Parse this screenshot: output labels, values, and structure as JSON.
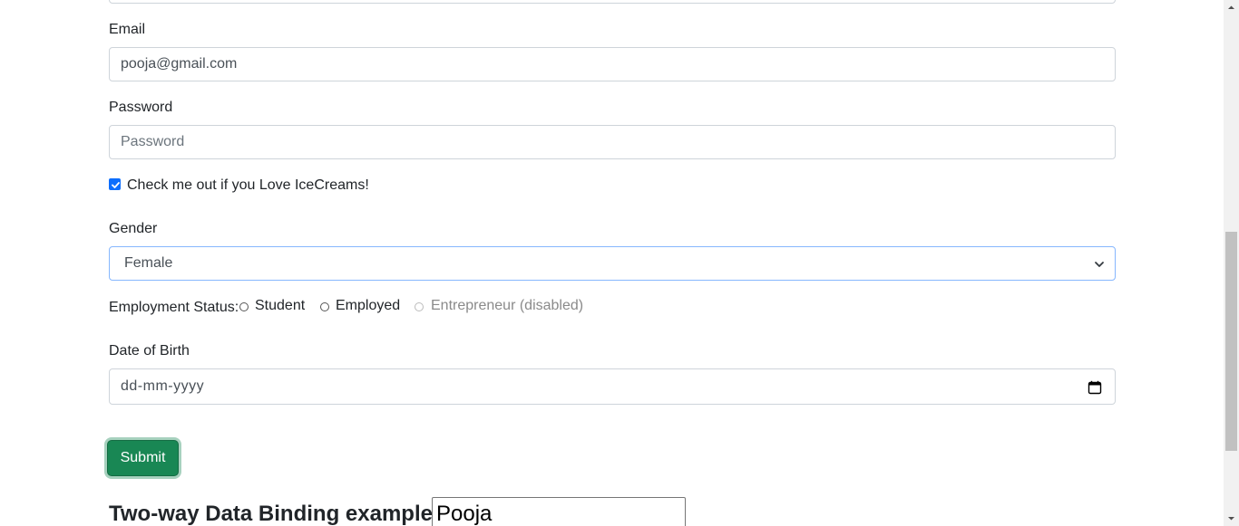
{
  "form": {
    "email_label": "Email",
    "email_value": "pooja@gmail.com",
    "password_label": "Password",
    "password_placeholder": "Password",
    "checkbox_label": "Check me out if you Love IceCreams!",
    "checkbox_checked": true,
    "gender_label": "Gender",
    "gender_selected": "Female",
    "employment_label": "Employment Status:",
    "employment_options": [
      {
        "label": "Student",
        "disabled": false
      },
      {
        "label": "Employed",
        "disabled": false
      },
      {
        "label": "Entrepreneur (disabled)",
        "disabled": true
      }
    ],
    "dob_label": "Date of Birth",
    "dob_placeholder": "dd-mm-yyyy",
    "submit_label": "Submit"
  },
  "two_way": {
    "heading": "Two-way Data Binding example:",
    "value": "Pooja"
  },
  "icons": {
    "select": "chevron-down-icon",
    "date": "calendar-icon",
    "checkbox": "check-icon"
  },
  "colors": {
    "primary": "#0d6efd",
    "success": "#198754",
    "focus_border": "#86b7fe"
  }
}
